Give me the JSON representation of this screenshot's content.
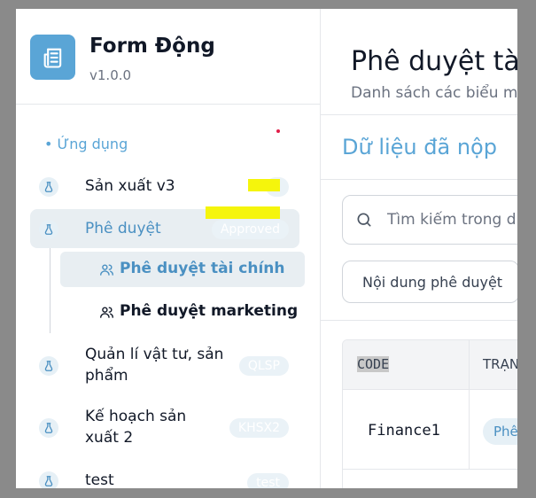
{
  "app": {
    "title": "Form Động",
    "version": "v1.0.0",
    "logo_icon": "newspaper-icon",
    "accent_color": "#5aa5d6"
  },
  "sidebar": {
    "section_label": "• Ứng dụng",
    "items": [
      {
        "label": "Sản xuất v3",
        "badge": "",
        "icon": "flask-icon",
        "active": false
      },
      {
        "label": "Phê duyệt",
        "badge": "Approved",
        "icon": "flask-icon",
        "active": true,
        "children": [
          {
            "label": "Phê duyệt tài chính",
            "icon": "users-icon",
            "active": true
          },
          {
            "label": "Phê duyệt marketing",
            "icon": "users-icon",
            "active": false
          }
        ]
      },
      {
        "label_lines": [
          "Quản lí vật tư, sản",
          "phẩm"
        ],
        "badge": "QLSP",
        "icon": "flask-icon",
        "active": false
      },
      {
        "label_lines": [
          "Kế hoạch sản",
          "xuất 2"
        ],
        "badge": "KHSX2",
        "icon": "flask-icon",
        "active": false
      },
      {
        "label": "test",
        "badge": "test",
        "icon": "flask-icon",
        "active": false
      }
    ]
  },
  "main": {
    "title": "Phê duyệt tài",
    "subtitle": "Danh sách các biểu m",
    "card_title": "Dữ liệu đã nộp",
    "search_placeholder": "Tìm kiếm trong d",
    "tab_label": "Nội dung phê duyệt",
    "table": {
      "headers": [
        "CODE",
        "TRẠN"
      ],
      "rows": [
        {
          "code": "Finance1",
          "status": "Phê"
        }
      ]
    }
  }
}
